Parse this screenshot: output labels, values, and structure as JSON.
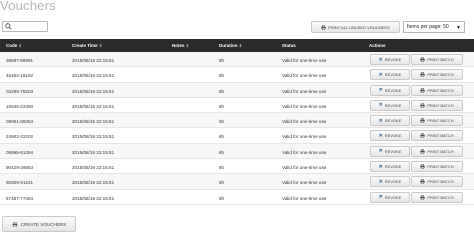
{
  "page": {
    "title": "Vouchers"
  },
  "search": {
    "placeholder": ""
  },
  "toolbar": {
    "print_all_label": "PRINT ALL UNUSED VOUCHERS",
    "items_per_page_label": "Items per page: 50"
  },
  "table": {
    "headers": {
      "code": "Code",
      "create_time": "Create Time",
      "notes": "Notes",
      "duration": "Duration",
      "status": "Status",
      "actions": "Actions"
    },
    "rows": [
      {
        "code": "38697-69991",
        "create_time": "2015/08/19 22:15:51",
        "duration": "8h",
        "status": "Valid for one-time use",
        "revoke": "REVOKE",
        "print": "PRINT BATCH"
      },
      {
        "code": "45452-18162",
        "create_time": "2015/08/19 22:15:51",
        "duration": "8h",
        "status": "Valid for one-time use",
        "revoke": "REVOKE",
        "print": "PRINT BATCH"
      },
      {
        "code": "02299-76203",
        "create_time": "2015/08/19 22:15:51",
        "duration": "8h",
        "status": "Valid for one-time use",
        "revoke": "REVOKE",
        "print": "PRINT BATCH"
      },
      {
        "code": "10645-22490",
        "create_time": "2015/08/19 22:15:51",
        "duration": "8h",
        "status": "Valid for one-time use",
        "revoke": "REVOKE",
        "print": "PRINT BATCH"
      },
      {
        "code": "09061-69353",
        "create_time": "2015/08/19 22:15:51",
        "duration": "8h",
        "status": "Valid for one-time use",
        "revoke": "REVOKE",
        "print": "PRINT BATCH"
      },
      {
        "code": "24902-22202",
        "create_time": "2015/08/19 22:15:51",
        "duration": "8h",
        "status": "Valid for one-time use",
        "revoke": "REVOKE",
        "print": "PRINT BATCH"
      },
      {
        "code": "05995-51394",
        "create_time": "2015/08/19 22:15:51",
        "duration": "8h",
        "status": "Valid for one-time use",
        "revoke": "REVOKE",
        "print": "PRINT BATCH"
      },
      {
        "code": "90429-29863",
        "create_time": "2015/08/19 22:15:51",
        "duration": "8h",
        "status": "Valid for one-time use",
        "revoke": "REVOKE",
        "print": "PRINT BATCH"
      },
      {
        "code": "90309-91241",
        "create_time": "2015/08/19 22:15:51",
        "duration": "8h",
        "status": "Valid for one-time use",
        "revoke": "REVOKE",
        "print": "PRINT BATCH"
      },
      {
        "code": "57487-77404",
        "create_time": "2015/08/19 22:15:51",
        "duration": "8h",
        "status": "Valid for one-time use",
        "revoke": "REVOKE",
        "print": "PRINT BATCH"
      }
    ]
  },
  "footer": {
    "create_label": "CREATE VOUCHERS"
  },
  "icons": {
    "search": "search-icon",
    "print": "printer-icon",
    "revoke": "x-icon",
    "create": "printer-icon"
  }
}
